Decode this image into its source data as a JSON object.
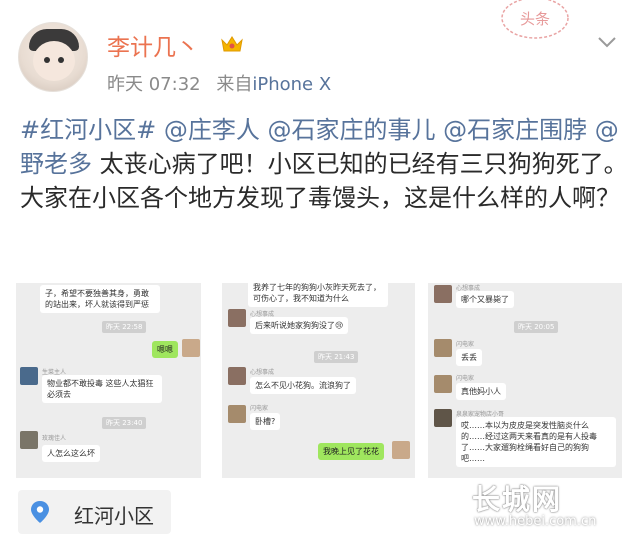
{
  "post": {
    "username": "李计几丶",
    "time": "昨天 07:32",
    "source_prefix": "来自",
    "source": "iPhone X",
    "tags": [
      "#红河小区#",
      "@庄李人",
      "@石家庄的事儿",
      "@石家庄围脖",
      "@野老多"
    ],
    "text": "太丧心病了吧！小区已知的已经有三只狗狗死了。大家在小区各个地方发现了毒馒头，这是什么样的人啊？",
    "stamp_text": "头条"
  },
  "chat1": {
    "msg1": "子，希望不要独善其身，勇敢的站出来，坏人就该得到严惩",
    "time1": "昨天 22:58",
    "msg2": "嗯嗯",
    "nick1": "生菜主人",
    "msg3": "物业都不敢投毒  这些人太猖狂必须去",
    "time2": "昨天 23:40",
    "nick2": "玫瑰佳人",
    "msg4": "人怎么这么坏"
  },
  "chat2": {
    "msg1": "我养了七年的狗狗小灰昨天死去了，可伤心了，我不知道为什么",
    "nick1": "心想事成",
    "msg2": "后来听说她家狗狗没了😢",
    "time1": "昨天 21:43",
    "nick2": "心想事成",
    "msg3": "怎么不见小花狗。流浪狗了",
    "nick3": "闪电家",
    "msg4": "卧槽?",
    "msg5": "我晚上见了花花"
  },
  "chat3": {
    "nick1": "心想事成",
    "msg1": "哪个又暴毙了",
    "time1": "昨天 20:05",
    "nick2": "闪电家",
    "msg2": "丢丢",
    "nick3": "闪电家",
    "msg3": "真他妈小人",
    "nick4": "泉泉家宠物店小哥",
    "msg4": "哎……本以为皮皮是突发性脑炎什么的……经过这两天来看真的是有人投毒了……大家遛狗栓绳看好自己的狗狗吧……"
  },
  "location": {
    "label": "红河小区"
  },
  "watermark": {
    "logo": "长城网",
    "url": "www.hebei.com.cn"
  },
  "colors": {
    "name": "#eb7350",
    "link": "#57739b",
    "text": "#2a2a2a",
    "meta": "#8a8a8a"
  }
}
